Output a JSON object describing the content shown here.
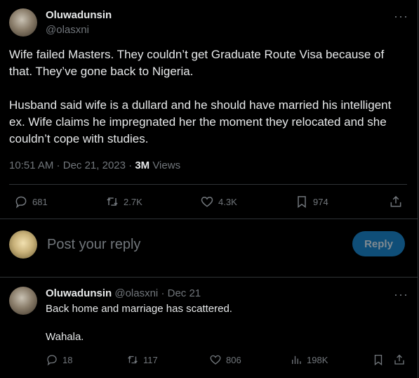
{
  "tweet": {
    "author_name": "Oluwadunsin",
    "author_handle": "@olasxni",
    "more": "···",
    "paragraph1": "Wife failed Masters. They couldn’t get Graduate Route Visa because of that. They’ve gone back to Nigeria.",
    "paragraph2": "Husband said wife is a dullard and he should have married his intelligent ex. Wife claims he impregnated her the moment they relocated and she couldn’t cope with studies.",
    "time": "10:51 AM",
    "date": "Dec 21, 2023",
    "views_count": "3M",
    "views_label": "Views",
    "actions": {
      "replies": "681",
      "reposts": "2.7K",
      "likes": "4.3K",
      "bookmarks": "974"
    }
  },
  "composer": {
    "placeholder": "Post your reply",
    "button_label": "Reply"
  },
  "reply": {
    "author_name": "Oluwadunsin",
    "author_handle": "@olasxni",
    "date": "Dec 21",
    "more": "···",
    "line1": "Back home and marriage has scattered.",
    "line2": "Wahala.",
    "actions": {
      "replies": "18",
      "reposts": "117",
      "likes": "806",
      "views": "198K"
    }
  },
  "colors": {
    "background": "#000000",
    "text": "#e7e9ea",
    "muted": "#71767b",
    "divider": "#2f3336",
    "reply_button": "#0f4e78"
  },
  "icons": [
    "more-icon",
    "reply-icon",
    "repost-icon",
    "like-icon",
    "bookmark-icon",
    "share-icon",
    "views-icon"
  ]
}
